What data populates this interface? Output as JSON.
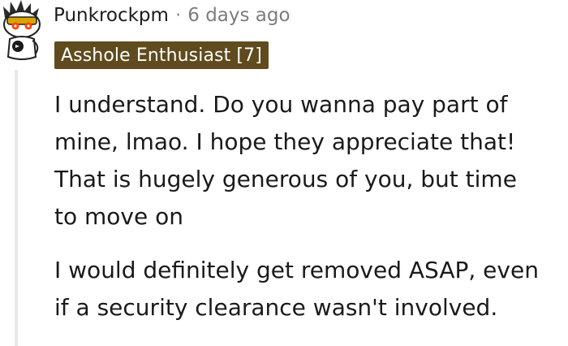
{
  "comment": {
    "author": "Punkrockpm",
    "separator": "·",
    "timestamp": "6 days ago",
    "flair": "Asshole Enthusiast [7]",
    "avatar_icon": "snoo-avatar-icon",
    "paragraphs": [
      {
        "lines": [
          "I understand. Do you wanna pay part of",
          "mine, lmao. I hope they appreciate that!",
          "That is hugely generous of you, but time",
          "to move on"
        ]
      },
      {
        "lines": [
          "I would definitely get removed ASAP, even",
          "if a security clearance wasn't involved."
        ]
      }
    ]
  },
  "colors": {
    "flair_background": "#5f4b1e",
    "thread_line": "#e6e8ea",
    "meta_text": "#7c7c7c"
  }
}
